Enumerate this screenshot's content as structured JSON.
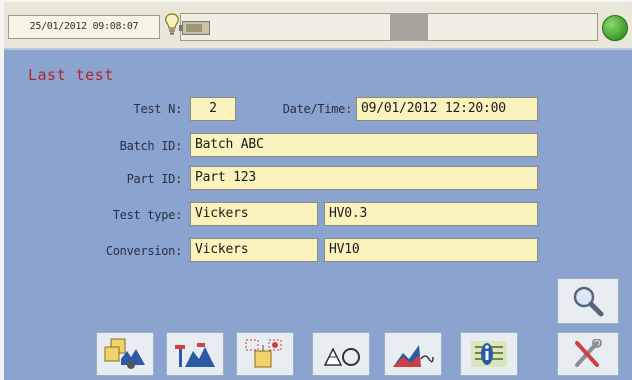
{
  "header": {
    "datetime": "25/01/2012  09:08:07"
  },
  "section": {
    "title": "Last test"
  },
  "form": {
    "test_no": {
      "label": "Test N:",
      "value": "2"
    },
    "datetime": {
      "label": "Date/Time:",
      "value": "09/01/2012  12:20:00"
    },
    "batch_id": {
      "label": "Batch ID:",
      "value": "Batch ABC"
    },
    "part_id": {
      "label": "Part ID:",
      "value": "Part 123"
    },
    "test_type": {
      "label": "Test type:",
      "method": "Vickers",
      "scale": "HV0.3"
    },
    "conversion": {
      "label": "Conversion:",
      "method": "Vickers",
      "scale": "HV10"
    }
  },
  "icons": {
    "search": "magnifier-icon",
    "settings": "tools-icon",
    "toolbar": [
      "batch-icon",
      "parts-icon",
      "test-position-icon",
      "indentation-icon",
      "chart-icon",
      "info-icon"
    ]
  },
  "colors": {
    "screen_bg": "#8aa3cf",
    "field_bg": "#fbf3bd",
    "title_red": "#b0282a",
    "status_led": "#3c9a2b"
  }
}
